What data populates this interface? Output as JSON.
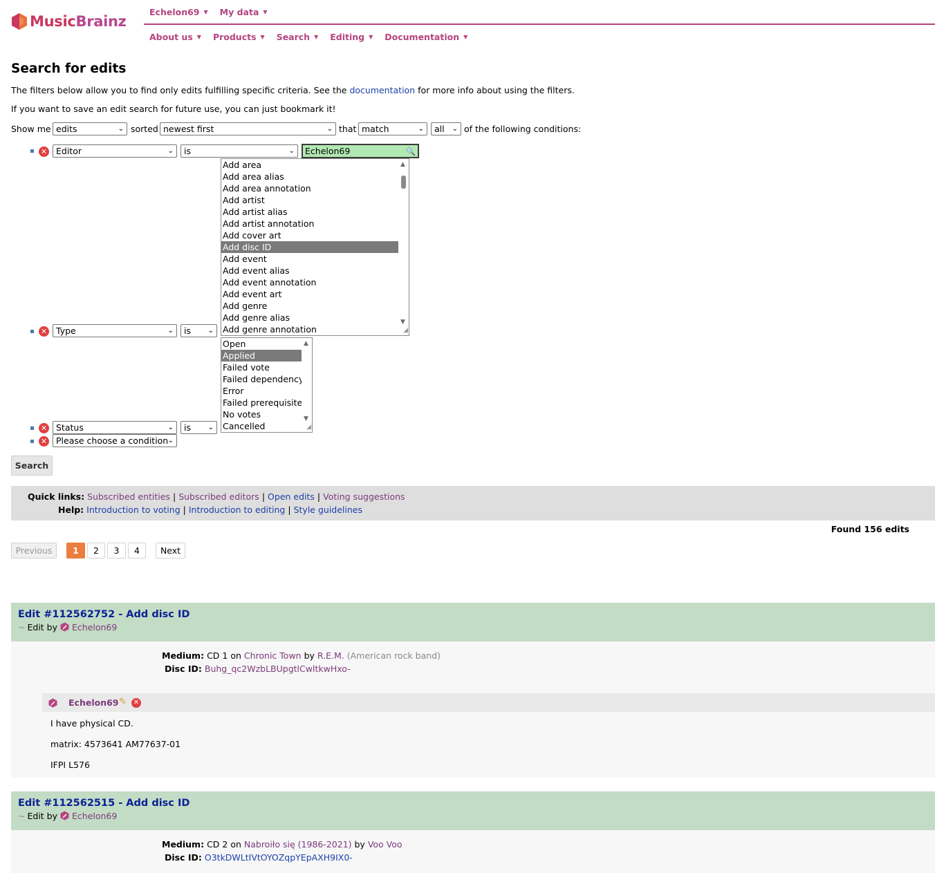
{
  "header": {
    "logo": {
      "part1": "Music",
      "part2": "Brainz"
    },
    "top_menu": [
      "Echelon69",
      "My data"
    ],
    "main_menu": [
      "About us",
      "Products",
      "Search",
      "Editing",
      "Documentation"
    ]
  },
  "page": {
    "title": "Search for edits",
    "intro1_before": "The filters below allow you to find only edits fulfilling specific criteria. See the ",
    "intro1_link": "documentation",
    "intro1_after": " for more info about using the filters.",
    "intro2": "If you want to save an edit search for future use, you can just bookmark it!"
  },
  "filter": {
    "show_me_label": "Show me",
    "show_me_value": "edits",
    "sorted_label": "sorted",
    "sorted_value": "newest first",
    "that_label": "that",
    "match_value": "match",
    "all_value": "all",
    "conditions_label": "of the following conditions:",
    "conditions": [
      {
        "field": "Editor",
        "op": "is",
        "value": "Echelon69"
      },
      {
        "field": "Type",
        "op": "is"
      },
      {
        "field": "Status",
        "op": "is"
      },
      {
        "field": "Please choose a condition"
      }
    ],
    "type_options": [
      "Add area",
      "Add area alias",
      "Add area annotation",
      "Add artist",
      "Add artist alias",
      "Add artist annotation",
      "Add cover art",
      "Add disc ID",
      "Add event",
      "Add event alias",
      "Add event annotation",
      "Add event art",
      "Add genre",
      "Add genre alias",
      "Add genre annotation"
    ],
    "type_selected": "Add disc ID",
    "status_options": [
      "Open",
      "Applied",
      "Failed vote",
      "Failed dependency",
      "Error",
      "Failed prerequisite",
      "No votes",
      "Cancelled"
    ],
    "status_selected": "Applied",
    "search_button": "Search"
  },
  "quick_links": {
    "label": "Quick links:",
    "links": [
      "Subscribed entities",
      "Subscribed editors",
      "Open edits",
      "Voting suggestions"
    ],
    "help_label": "Help:",
    "help_links": [
      "Introduction to voting",
      "Introduction to editing",
      "Style guidelines"
    ]
  },
  "results": {
    "found": "Found 156 edits",
    "pagination": {
      "previous": "Previous",
      "pages": [
        "1",
        "2",
        "3",
        "4"
      ],
      "current": "1",
      "next": "Next"
    }
  },
  "edits": [
    {
      "title": "Edit #112562752 - Add disc ID",
      "edit_by": "Edit by",
      "editor": "Echelon69",
      "medium_label": "Medium:",
      "medium_prefix": "CD 1 on",
      "release": "Chronic Town",
      "by": "by",
      "artist": "R.E.M.",
      "artist_comment": "(American rock band)",
      "discid_label": "Disc ID:",
      "discid": "Buhg_qc2WzbLBUpgtlCwltkwHxo-",
      "note": {
        "author": "Echelon69",
        "lines": [
          "I have physical CD.",
          "matrix: 4573641 AM77637-01",
          "IFPI L576"
        ]
      }
    },
    {
      "title": "Edit #112562515 - Add disc ID",
      "edit_by": "Edit by",
      "editor": "Echelon69",
      "medium_label": "Medium:",
      "medium_prefix": "CD 2 on",
      "release": "Nabroiło się (1986-2021)",
      "by": "by",
      "artist": "Voo Voo",
      "discid_label": "Disc ID:",
      "discid": "O3tkDWLtIVtOYOZqpYEpAXH9IX0-"
    }
  ],
  "colors": {
    "brand": "#b4447f",
    "edit_header": "#c3dcc5",
    "current_page": "#ea7e3e",
    "link": "#0b2296"
  }
}
